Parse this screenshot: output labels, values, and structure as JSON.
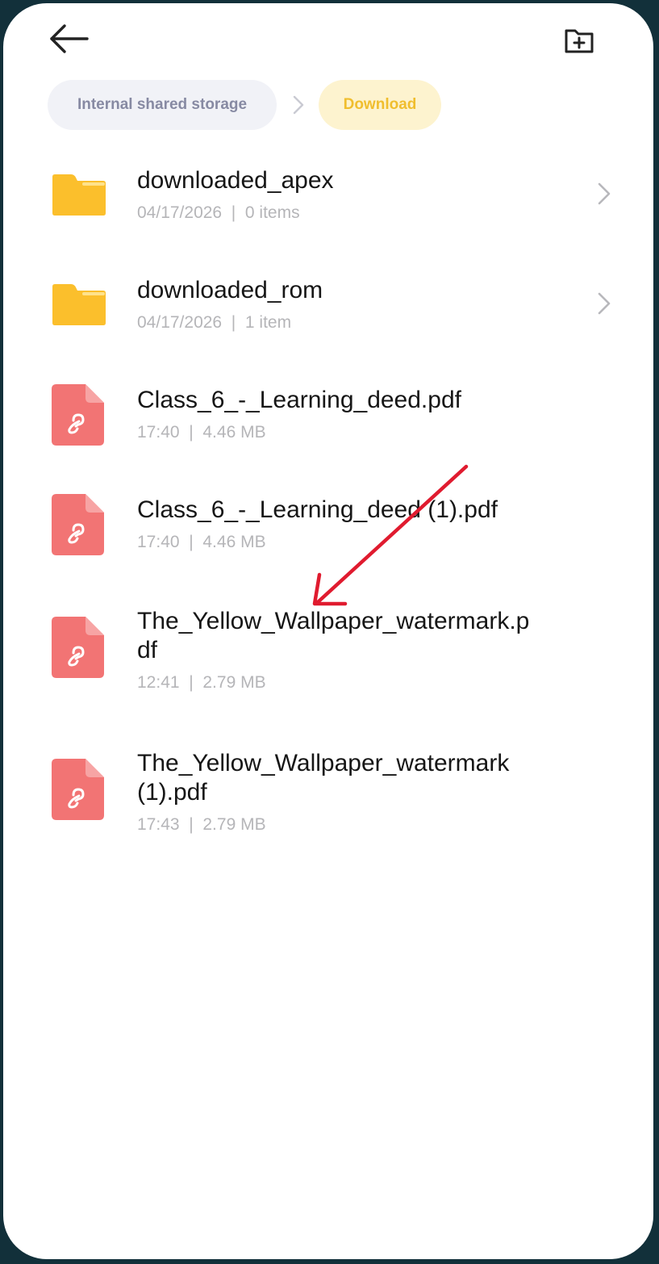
{
  "header": {
    "back_icon": "arrow-left-icon",
    "new_folder_icon": "folder-plus-icon"
  },
  "breadcrumb": {
    "items": [
      {
        "label": "Internal shared storage"
      },
      {
        "label": "Download"
      }
    ],
    "separator_icon": "chevron-right-icon"
  },
  "files": [
    {
      "name": "downloaded_apex",
      "date": "04/17/2026",
      "detail": "0 items",
      "kind": "folder"
    },
    {
      "name": "downloaded_rom",
      "date": "04/17/2026",
      "detail": "1 item",
      "kind": "folder"
    },
    {
      "name": "Class_6_-_Learning_deed.pdf",
      "date": "17:40",
      "detail": "4.46 MB",
      "kind": "pdf"
    },
    {
      "name": "Class_6_-_Learning_deed (1).pdf",
      "date": "17:40",
      "detail": "4.46 MB",
      "kind": "pdf"
    },
    {
      "name": "The_Yellow_Wallpaper_watermark.pdf",
      "date": "12:41",
      "detail": "2.79 MB",
      "kind": "pdf"
    },
    {
      "name": "The_Yellow_Wallpaper_watermark (1).pdf",
      "date": "17:43",
      "detail": "2.79 MB",
      "kind": "pdf"
    }
  ],
  "meta_separator": "|",
  "colors": {
    "folder": "#fbbf2c",
    "pdf": "#f27474",
    "accent": "#f0be2e",
    "annotation_arrow": "#e01b2f"
  }
}
